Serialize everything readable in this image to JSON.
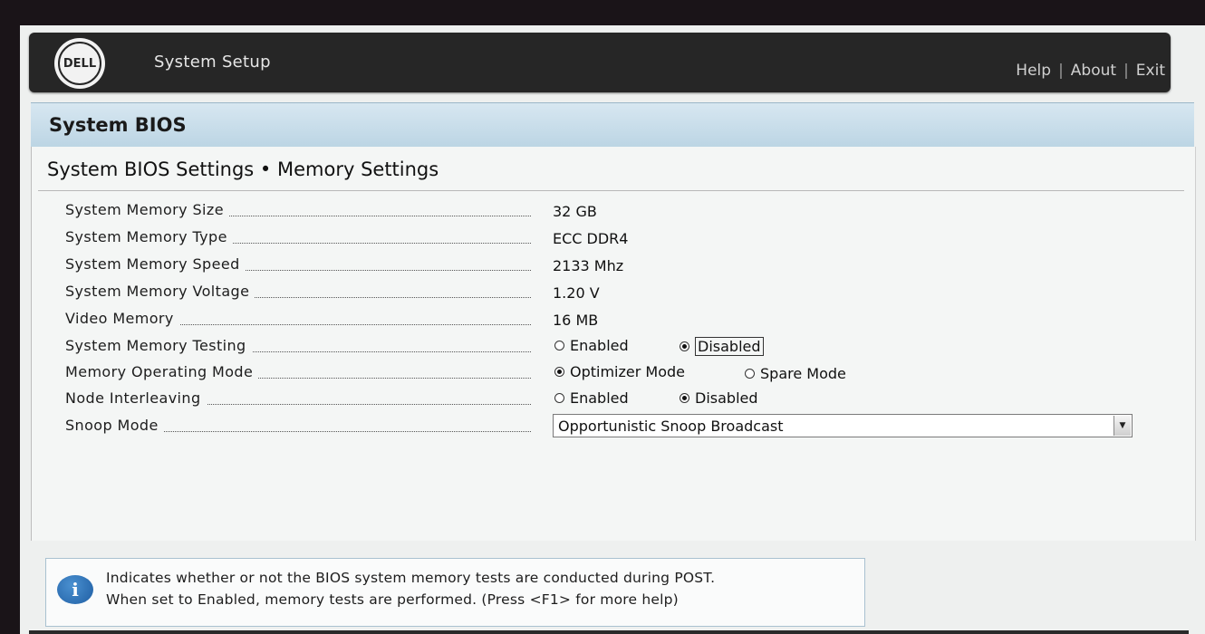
{
  "header": {
    "logo_text": "DELL",
    "app_title": "System Setup",
    "links": [
      "Help",
      "About",
      "Exit"
    ],
    "separator": "|"
  },
  "section": {
    "title": "System BIOS",
    "subtitle": "System BIOS Settings • Memory Settings"
  },
  "settings": {
    "memory_size": {
      "label": "System Memory Size",
      "value": "32 GB"
    },
    "memory_type": {
      "label": "System Memory Type",
      "value": "ECC DDR4"
    },
    "memory_speed": {
      "label": "System Memory Speed",
      "value": "2133 Mhz"
    },
    "memory_voltage": {
      "label": "System Memory Voltage",
      "value": "1.20 V"
    },
    "video_memory": {
      "label": "Video Memory",
      "value": "16 MB"
    },
    "memory_testing": {
      "label": "System Memory Testing",
      "options": [
        "Enabled",
        "Disabled"
      ],
      "selected": "Disabled"
    },
    "operating_mode": {
      "label": "Memory Operating Mode",
      "options": [
        "Optimizer Mode",
        "Spare Mode"
      ],
      "selected": "Optimizer Mode"
    },
    "node_interleaving": {
      "label": "Node Interleaving",
      "options": [
        "Enabled",
        "Disabled"
      ],
      "selected": "Disabled"
    },
    "snoop_mode": {
      "label": "Snoop Mode",
      "value": "Opportunistic Snoop Broadcast"
    }
  },
  "help": {
    "icon": "info-icon",
    "line1": "Indicates whether or not the BIOS system memory tests are conducted during POST.",
    "line2": "When set to Enabled, memory tests are performed. (Press <F1> for more help)"
  },
  "colors": {
    "header_bg": "#262626",
    "band_bg": "#c8dde9",
    "info_icon": "#2a6fb5"
  }
}
